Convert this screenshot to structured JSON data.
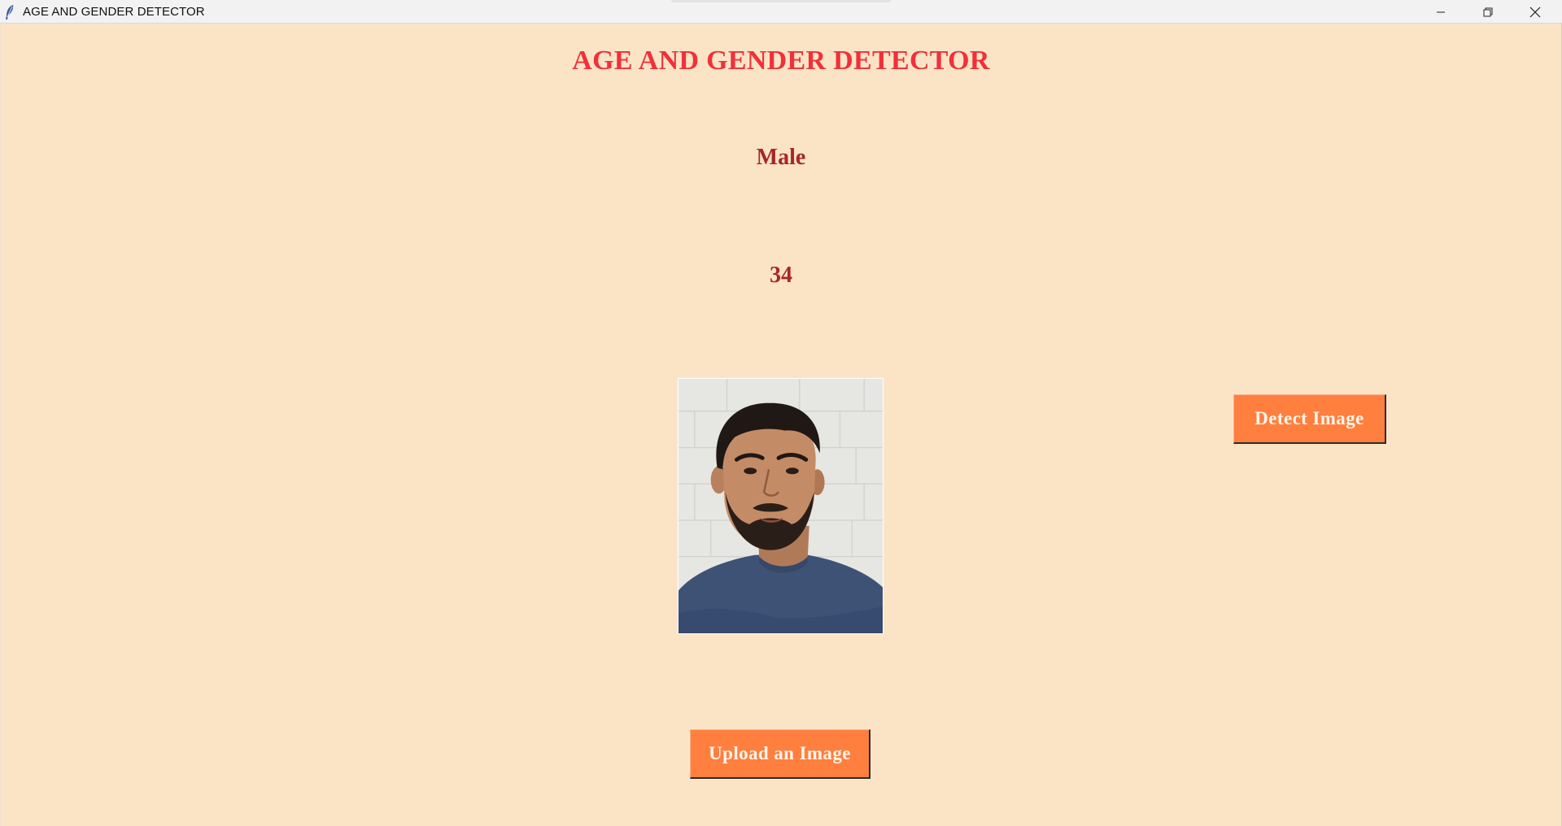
{
  "window": {
    "title": "AGE AND GENDER DETECTOR",
    "icon": "feather-icon",
    "controls": [
      "minimize-icon",
      "restore-icon",
      "close-icon"
    ]
  },
  "main": {
    "heading": "AGE AND GENDER DETECTOR",
    "gender_result": "Male",
    "age_result": "34",
    "detect_button_label": "Detect Image",
    "upload_button_label": "Upload an Image"
  },
  "colors": {
    "background": "#fbe4c6",
    "heading": "#f2303a",
    "result_text": "#a8262a",
    "button": "#ff7f3f",
    "button_text": "#fff5ea"
  }
}
